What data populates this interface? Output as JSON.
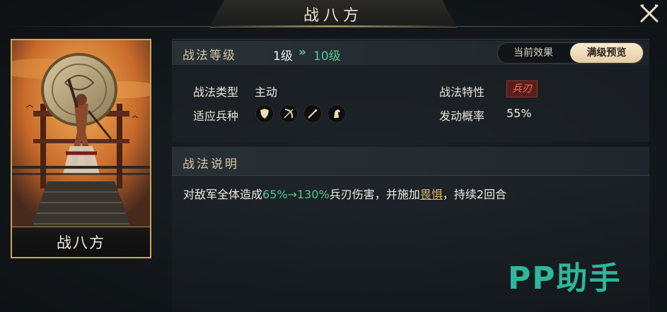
{
  "header": {
    "title": "战八方"
  },
  "card": {
    "name": "战八方"
  },
  "level": {
    "label": "战法等级",
    "current": "1级",
    "arrow": "»",
    "max": "10级"
  },
  "toggle": {
    "current_effect": "当前效果",
    "max_preview": "满级预览",
    "selected": "满级预览"
  },
  "attributes": {
    "type_label": "战法类型",
    "type_value": "主动",
    "trait_label": "战法特性",
    "trait_value": "兵刃",
    "troops_label": "适应兵种",
    "troops": [
      "shield-icon",
      "bow-icon",
      "spear-icon",
      "horse-icon"
    ],
    "rate_label": "发动概率",
    "rate_value": "55%"
  },
  "description": {
    "title": "战法说明",
    "part1": "对敌军全体造成",
    "value_from": "65%",
    "arrow": "→",
    "value_to": "130%",
    "part2": "兵刃伤害，并施加",
    "status": "畏惧",
    "part3": "，持续2回合"
  },
  "watermark": {
    "text": "PP助手"
  },
  "colors": {
    "accent_green": "#56c596",
    "gold": "#c9a45a",
    "badge_red": "#5a1d1a",
    "watermark": "#2fc5a6"
  }
}
